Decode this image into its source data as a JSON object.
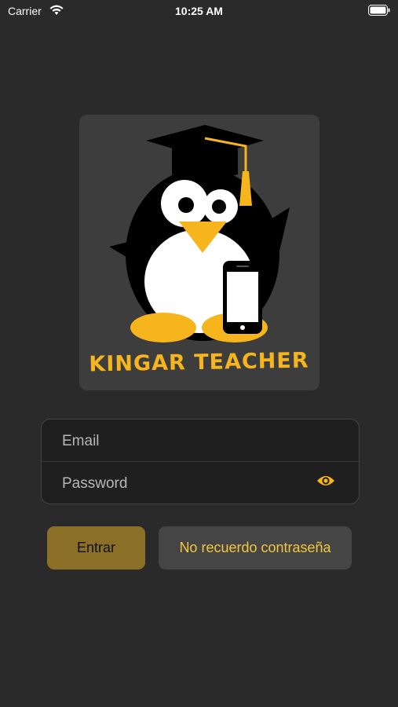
{
  "status_bar": {
    "carrier": "Carrier",
    "time": "10:25 AM",
    "wifi_icon": "wifi-icon",
    "battery_icon": "battery-full-icon"
  },
  "logo": {
    "icon": "penguin-graduate-phone-logo",
    "text": "KINGAR TEACHER"
  },
  "form": {
    "email": {
      "placeholder": "Email",
      "value": ""
    },
    "password": {
      "placeholder": "Password",
      "value": "",
      "toggle_icon": "eye-icon"
    }
  },
  "buttons": {
    "enter_label": "Entrar",
    "forgot_label": "No recuerdo contraseña"
  },
  "colors": {
    "background": "#2a2a2a",
    "accent": "#f6b51c",
    "enter_button": "#8b6f27",
    "forgot_button": "#454545",
    "forgot_text": "#f4c83a"
  }
}
